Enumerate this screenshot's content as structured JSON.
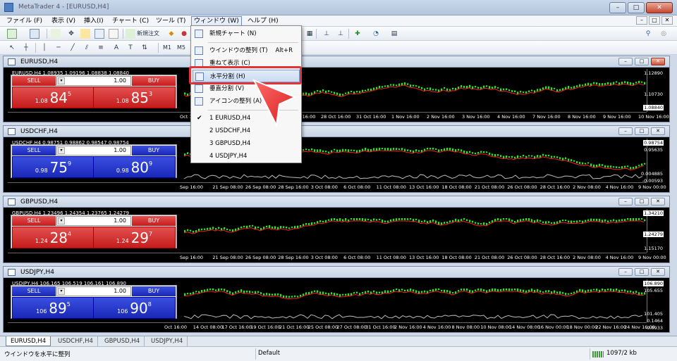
{
  "window": {
    "title": "MetaTrader 4 - [EURUSD,H4]",
    "controls": [
      "–",
      "□",
      "✕"
    ]
  },
  "menubar": {
    "items": [
      {
        "label": "ファイル (F)"
      },
      {
        "label": "表示 (V)"
      },
      {
        "label": "挿入(I)"
      },
      {
        "label": "チャート (C)"
      },
      {
        "label": "ツール (T)"
      },
      {
        "label": "ウィンドウ (W)"
      },
      {
        "label": "ヘルプ (H)"
      }
    ],
    "active": "ウィンドウ (W)"
  },
  "toolbar": {
    "new_order_label": "新規注文",
    "timeframes": [
      "M1",
      "M5"
    ]
  },
  "window_menu": {
    "items": [
      {
        "label": "新規チャート (N)",
        "shortcut": "",
        "icon": "new-chart-icon"
      },
      {
        "label": "ウインドウの整列 (T)",
        "shortcut": "Alt+R",
        "icon": "tile-windows-icon"
      },
      {
        "label": "重ねて表示 (C)",
        "shortcut": "",
        "icon": "cascade-icon"
      },
      {
        "label": "水平分割 (H)",
        "shortcut": "",
        "icon": "tile-horizontal-icon",
        "highlighted": true
      },
      {
        "label": "垂直分割 (V)",
        "shortcut": "",
        "icon": "tile-vertical-icon"
      },
      {
        "label": "アイコンの整列 (A)",
        "shortcut": "",
        "icon": "arrange-icons-icon"
      }
    ],
    "windows": [
      {
        "label": "1 EURUSD,H4",
        "checked": true
      },
      {
        "label": "2 USDCHF,H4",
        "checked": false
      },
      {
        "label": "3 GBPUSD,H4",
        "checked": false
      },
      {
        "label": "4 USDJPY,H4",
        "checked": false
      }
    ]
  },
  "charts": [
    {
      "title": "EURUSD,H4",
      "info": "EURUSD,H4  1.08935 1.09196 1.08838 1.08840",
      "color": "red",
      "sell": "SELL",
      "buy": "BUY",
      "lot": "1.00",
      "bid": {
        "prefix": "1.08",
        "big": "84",
        "sup": "5"
      },
      "ask": {
        "prefix": "1.08",
        "big": "85",
        "sup": "3"
      },
      "yticks": [
        "1.12890",
        "1.10730",
        "1.08840"
      ],
      "xticks": [
        "Oct 16:00",
        "25 Oct 16:00",
        "26 Oct 16:00",
        "27 Oct 16:00",
        "28 Oct 16:00",
        "31 Oct 16:00",
        "1 Nov 16:00",
        "2 Nov 16:00",
        "3 Nov 16:00",
        "4 Nov 16:00",
        "7 Nov 16:00",
        "8 Nov 16:00",
        "9 Nov 16:00",
        "10 Nov 16:00"
      ]
    },
    {
      "title": "USDCHF,H4",
      "info": "USDCHF,H4  0.98751 0.98862 0.98547 0.98754",
      "color": "blue",
      "sell": "SELL",
      "buy": "BUY",
      "lot": "1.00",
      "bid": {
        "prefix": "0.98",
        "big": "75",
        "sup": "9"
      },
      "ask": {
        "prefix": "0.98",
        "big": "80",
        "sup": "9"
      },
      "yticks": [
        "0.98754",
        "0.95635",
        "0.004885",
        "-0.00593"
      ],
      "xticks": [
        "Sep 16:00",
        "21 Sep 08:00",
        "26 Sep 08:00",
        "28 Sep 16:00",
        "3 Oct 08:00",
        "6 Oct 08:00",
        "11 Oct 08:00",
        "13 Oct 16:00",
        "18 Oct 08:00",
        "21 Oct 08:00",
        "26 Oct 08:00",
        "28 Oct 16:00",
        "2 Nov 08:00",
        "4 Nov 16:00",
        "9 Nov 00:00"
      ]
    },
    {
      "title": "GBPUSD,H4",
      "info": "GBPUSD,H4  1.23496 1.24354 1.23765 1.24279",
      "color": "red",
      "sell": "SELL",
      "buy": "BUY",
      "lot": "1.00",
      "bid": {
        "prefix": "1.24",
        "big": "28",
        "sup": "4"
      },
      "ask": {
        "prefix": "1.24",
        "big": "29",
        "sup": "7"
      },
      "yticks": [
        "1.34210",
        "1.24279",
        "1.15170"
      ],
      "xticks": [
        "Sep 16:00",
        "21 Sep 08:00",
        "26 Sep 08:00",
        "28 Sep 16:00",
        "3 Oct 08:00",
        "6 Oct 08:00",
        "11 Oct 08:00",
        "13 Oct 16:00",
        "18 Oct 08:00",
        "21 Oct 08:00",
        "26 Oct 08:00",
        "28 Oct 16:00",
        "2 Nov 08:00",
        "4 Nov 16:00",
        "9 Nov 00:00"
      ]
    },
    {
      "title": "USDJPY,H4",
      "info": "USDJPY,H4  106.165 106.519 106.161 106.890",
      "color": "blue",
      "sell": "SELL",
      "buy": "BUY",
      "lot": "1.00",
      "bid": {
        "prefix": "106",
        "big": "89",
        "sup": "5"
      },
      "ask": {
        "prefix": "106",
        "big": "90",
        "sup": "8"
      },
      "yticks": [
        "106.890",
        "105.655",
        "101.405",
        "0.1464",
        "-0.0933"
      ],
      "xticks": [
        "Oct 16:00",
        "14 Oct 08:00",
        "17 Oct 16:00",
        "19 Oct 16:00",
        "21 Oct 16:00",
        "25 Oct 08:00",
        "27 Oct 08:00",
        "31 Oct 16:00",
        "2 Nov 16:00",
        "4 Nov 16:00",
        "8 Nov 08:00",
        "10 Nov 08:00",
        "14 Nov 08:00",
        "16 Nov 00:00",
        "18 Nov 00:00",
        "22 Nov 16:00",
        "24 Nov 16:00"
      ]
    }
  ],
  "tabs": [
    "EURUSD,H4",
    "USDCHF,H4",
    "GBPUSD,H4",
    "USDJPY,H4"
  ],
  "status": {
    "hint": "ウインドウを水平に整列",
    "profile": "Default",
    "traffic": "1097/2 kb"
  },
  "colors": {
    "sell_red": "#d42a2a",
    "buy_blue": "#2235cc",
    "candles": "#00ff00",
    "ma": "#ff2020",
    "highlight": "#e23434"
  }
}
